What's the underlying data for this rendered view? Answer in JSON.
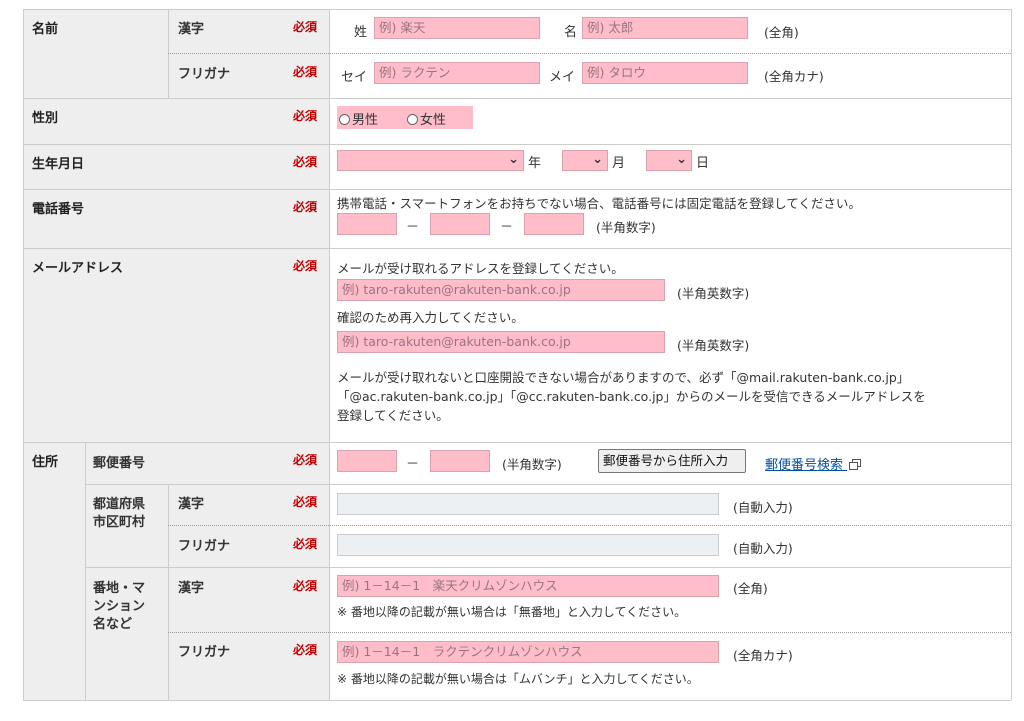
{
  "required": "必須",
  "name": {
    "label": "名前",
    "kanji_label": "漢字",
    "furigana_label": "フリガナ",
    "sei_kanji": "姓",
    "sei_kanji_ph": "例) 楽天",
    "mei_kanji": "名",
    "mei_kanji_ph": "例) 太郎",
    "kanji_note": "(全角)",
    "sei_kana": "セイ",
    "sei_kana_ph": "例) ラクテン",
    "mei_kana": "メイ",
    "mei_kana_ph": "例) タロウ",
    "kana_note": "(全角カナ)"
  },
  "gender": {
    "label": "性別",
    "male": "男性",
    "female": "女性"
  },
  "birth": {
    "label": "生年月日",
    "year": "年",
    "month": "月",
    "day": "日"
  },
  "phone": {
    "label": "電話番号",
    "note": "携帯電話・スマートフォンをお持ちでない場合、電話番号には固定電話を登録してください。",
    "dash": "－",
    "format": "(半角数字)"
  },
  "email": {
    "label": "メールアドレス",
    "intro": "メールが受け取れるアドレスを登録してください。",
    "placeholder": "例) taro-rakuten@rakuten-bank.co.jp",
    "format": "(半角英数字)",
    "confirm": "確認のため再入力してください。",
    "warning1": "メールが受け取れないと口座開設できない場合がありますので、必ず「@mail.rakuten-bank.co.jp」",
    "warning2": "「@ac.rakuten-bank.co.jp」「@cc.rakuten-bank.co.jp」からのメールを受信できるメールアドレスを",
    "warning3": "登録してください。"
  },
  "address": {
    "label": "住所",
    "postal_label": "郵便番号",
    "postal_format": "(半角数字)",
    "postal_button": "郵便番号から住所入力",
    "postal_search": "郵便番号検索",
    "pref_label_1": "都道府県",
    "pref_label_2": "市区町村",
    "kanji_label": "漢字",
    "furigana_label": "フリガナ",
    "auto": "(自動入力)",
    "banchi_label_1": "番地・マ",
    "banchi_label_2": "ンション",
    "banchi_label_3": "名など",
    "banchi_kanji_ph": "例) 1－14－1　楽天クリムゾンハウス",
    "banchi_kanji_note": "(全角)",
    "banchi_kanji_hint": "※ 番地以降の記載が無い場合は「無番地」と入力してください。",
    "banchi_kana_ph": "例) 1－14－1　ラクテンクリムゾンハウス",
    "banchi_kana_note": "(全角カナ)",
    "banchi_kana_hint": "※ 番地以降の記載が無い場合は「ムバンチ」と入力してください。"
  }
}
